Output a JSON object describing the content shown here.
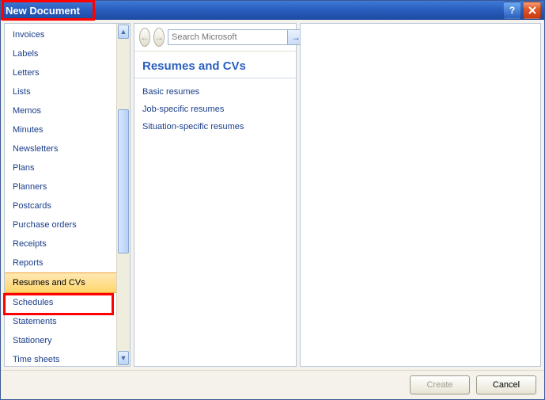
{
  "window": {
    "title": "New Document"
  },
  "sidebar": {
    "items": [
      {
        "label": "Invoices"
      },
      {
        "label": "Labels"
      },
      {
        "label": "Letters"
      },
      {
        "label": "Lists"
      },
      {
        "label": "Memos"
      },
      {
        "label": "Minutes"
      },
      {
        "label": "Newsletters"
      },
      {
        "label": "Plans"
      },
      {
        "label": "Planners"
      },
      {
        "label": "Postcards"
      },
      {
        "label": "Purchase orders"
      },
      {
        "label": "Receipts"
      },
      {
        "label": "Reports"
      },
      {
        "label": "Resumes and CVs"
      },
      {
        "label": "Schedules"
      },
      {
        "label": "Statements"
      },
      {
        "label": "Stationery"
      },
      {
        "label": "Time sheets"
      }
    ],
    "selected_index": 13
  },
  "search": {
    "placeholder": "Search Microsoft"
  },
  "main": {
    "heading": "Resumes and CVs",
    "links": [
      {
        "label": "Basic resumes"
      },
      {
        "label": "Job-specific resumes"
      },
      {
        "label": "Situation-specific resumes"
      }
    ]
  },
  "footer": {
    "create_label": "Create",
    "cancel_label": "Cancel"
  }
}
